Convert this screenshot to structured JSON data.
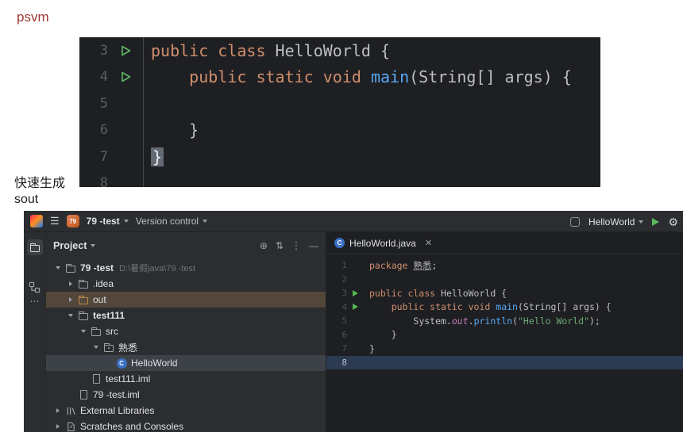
{
  "doc": {
    "psvm": "psvm",
    "generate_caption": "快速生成",
    "sout": "sout"
  },
  "icons": {
    "hamburger": "☰",
    "locate": "⊕",
    "collapse": "⇅",
    "more_vertical": "⋮",
    "hide": "—",
    "more_horizontal": "⋯",
    "close_tab": "✕",
    "gear": "⚙",
    "class_letter": "C"
  },
  "colors": {
    "keyword": "#cf8e6d",
    "method": "#56a8f5",
    "string": "#6aab73",
    "field": "#c77dbb",
    "run_green": "#57b757",
    "caret_line": "#2c3a52"
  },
  "snippet": {
    "nums": {
      "n3": "3",
      "n4": "4",
      "n5": "5",
      "n6": "6",
      "n7": "7",
      "n8": "8"
    },
    "l3": {
      "kw": "public class ",
      "tx": "HelloWorld {"
    },
    "l4": {
      "ind": "    ",
      "kw": "public static void ",
      "fn": "main",
      "tx": "(String[] args) {"
    },
    "l6": {
      "tx": "    }"
    },
    "l7": {
      "tx": "}"
    }
  },
  "ide": {
    "titlebar": {
      "project_badge": "79",
      "project_name": "79 -test",
      "vcs_label": "Version control",
      "run_config": "HelloWorld"
    },
    "project": {
      "title": "Project",
      "tree": [
        {
          "label": "79 -test",
          "suffix": "D:\\暑假java\\79 -test"
        },
        {
          "label": ".idea"
        },
        {
          "label": "out"
        },
        {
          "label": "test111"
        },
        {
          "label": "src"
        },
        {
          "label": "熟悉"
        },
        {
          "label": "HelloWorld"
        },
        {
          "label": "test111.iml"
        },
        {
          "label": "79 -test.iml"
        },
        {
          "label": "External Libraries"
        },
        {
          "label": "Scratches and Consoles"
        }
      ]
    },
    "editor": {
      "tab": "HelloWorld.java",
      "nums": {
        "n1": "1",
        "n2": "2",
        "n3": "3",
        "n4": "4",
        "n5": "5",
        "n6": "6",
        "n7": "7",
        "n8": "8"
      },
      "l1": {
        "kw": "package ",
        "id": "熟悉",
        "tx": ";"
      },
      "l3": {
        "kw": "public class ",
        "tx": "HelloWorld {"
      },
      "l4": {
        "ind": "    ",
        "kw": "public static void ",
        "fn": "main",
        "tx": "(String[] args) {"
      },
      "l5": {
        "ind": "        ",
        "a": "System.",
        "fld": "out",
        "b": ".",
        "fn": "println",
        "c": "(",
        "str": "\"Hello World\"",
        "d": ");"
      },
      "l6": {
        "tx": "    }"
      },
      "l7": {
        "tx": "}"
      }
    }
  }
}
